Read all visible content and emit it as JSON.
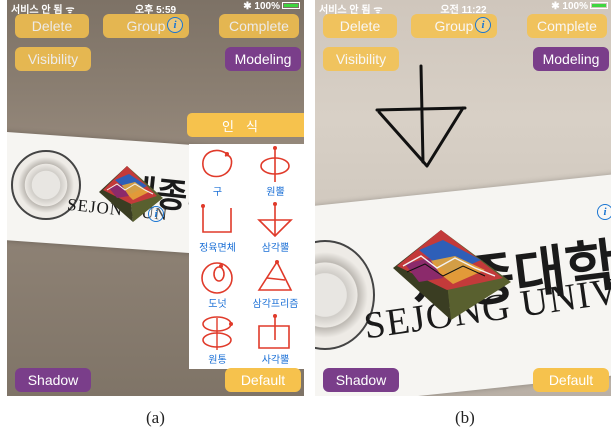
{
  "screens": [
    {
      "status": {
        "carrier": "서비스 안 됨 ᯤ",
        "time": "오후 5:59",
        "battery": "100%"
      },
      "buttons": {
        "delete": "Delete",
        "group": "Group",
        "complete": "Complete",
        "visibility": "Visibility",
        "modeling": "Modeling",
        "shadow": "Shadow",
        "default": "Default"
      },
      "recognize": "인식",
      "target": {
        "korean": "세종대",
        "english": "SEJONG UN"
      },
      "gestures": [
        "구",
        "원뿔",
        "정육면체",
        "삼각뿔",
        "도넛",
        "삼각프리즘",
        "원통",
        "사각뿔"
      ],
      "caption": "(a)"
    },
    {
      "status": {
        "carrier": "서비스 안 됨 ᯤ",
        "time": "오전 11:22",
        "battery": "100%"
      },
      "buttons": {
        "delete": "Delete",
        "group": "Group",
        "complete": "Complete",
        "visibility": "Visibility",
        "modeling": "Modeling",
        "shadow": "Shadow",
        "default": "Default"
      },
      "target": {
        "korean": "세종대학",
        "english": "SEJONG UNIVE"
      },
      "caption": "(b)"
    }
  ],
  "colors": {
    "button_yellow": "#f6c24d",
    "button_purple": "#7a3e8a",
    "gesture_label": "#1a6fd6",
    "gesture_stroke": "#e03a2a",
    "info_blue": "#1a75d2"
  }
}
